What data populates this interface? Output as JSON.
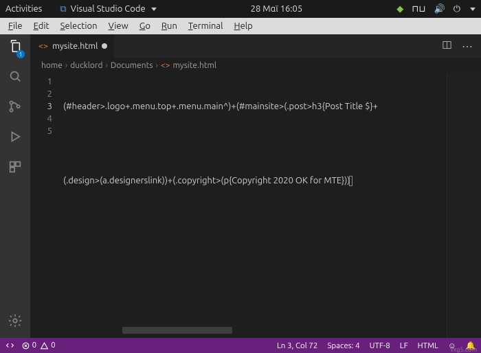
{
  "topbar": {
    "activities": "Activities",
    "app": "Visual Studio Code",
    "clock": "28 Μαϊ 16:05"
  },
  "menubar": {
    "file": "File",
    "edit": "Edit",
    "selection": "Selection",
    "view": "View",
    "go": "Go",
    "run": "Run",
    "terminal": "Terminal",
    "help": "Help"
  },
  "activitybar": {
    "explorer_badge": "1"
  },
  "tab": {
    "filename": "mysite.html"
  },
  "breadcrumb": {
    "p0": "home",
    "p1": "ducklord",
    "p2": "Documents",
    "p3": "mysite.html"
  },
  "code": {
    "lines": [
      "(#header>.logo+.menu.top+.menu.main^)+(#mainsite>(.post>h3{Post Title $}+",
      "",
      "(.design>(a.designerslink))+(.copyright>(p{Copyright 2020 OK for MTE}))",
      "",
      ""
    ],
    "line_numbers": [
      "1",
      "2",
      "3",
      "4",
      "5"
    ],
    "cursor_line": 3
  },
  "status": {
    "errors": "0",
    "warnings": "0",
    "pos": "Ln 3, Col 72",
    "spaces": "Spaces: 4",
    "enc": "UTF-8",
    "eol": "LF",
    "lang": "HTML",
    "bell": "bell"
  },
  "watermark": "vxg5.com"
}
